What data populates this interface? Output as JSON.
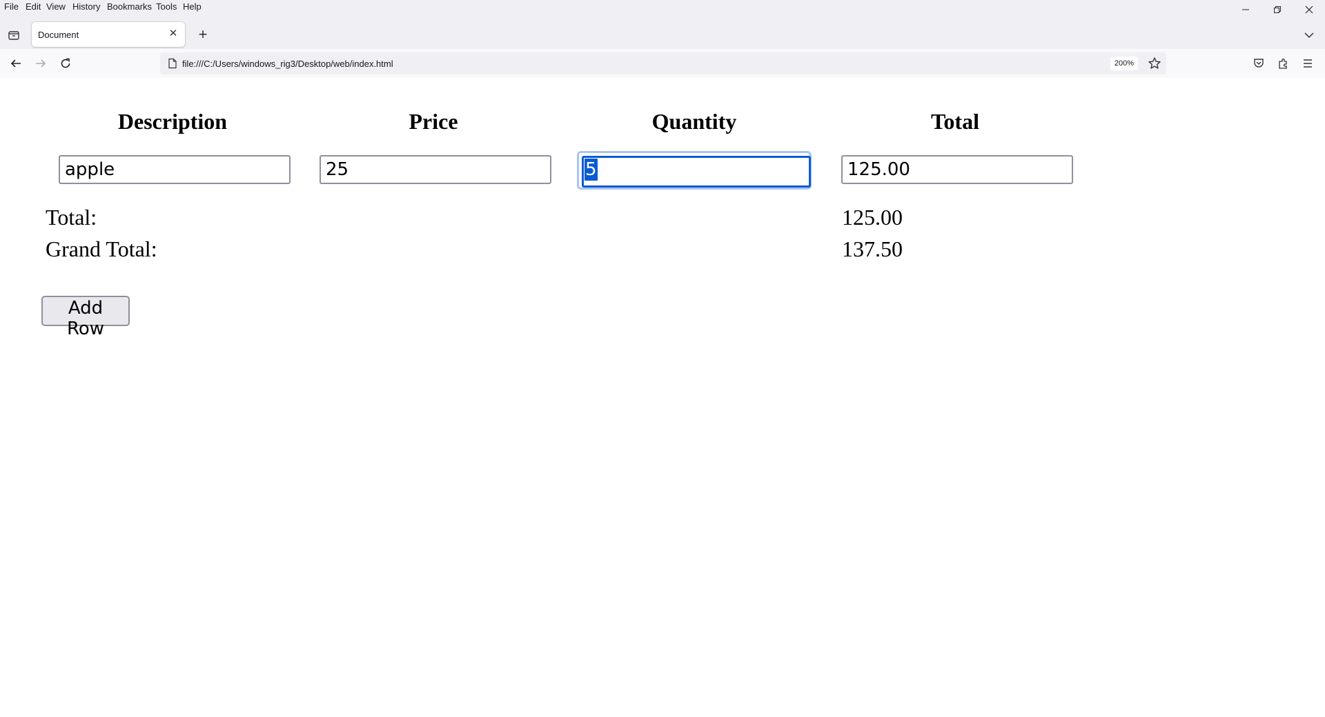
{
  "menu": [
    "File",
    "Edit",
    "View",
    "History",
    "Bookmarks",
    "Tools",
    "Help"
  ],
  "tab": {
    "title": "Document"
  },
  "address": {
    "url": "file:///C:/Users/windows_rig3/Desktop/web/index.html",
    "zoom": "200%"
  },
  "table": {
    "headers": {
      "description": "Description",
      "price": "Price",
      "quantity": "Quantity",
      "total": "Total"
    },
    "row": {
      "description": "apple",
      "price": "25",
      "quantity": "5",
      "total": "125.00"
    }
  },
  "summary": {
    "total_label": "Total:",
    "total_value": "125.00",
    "grand_label": "Grand Total:",
    "grand_value": "137.50"
  },
  "add_row_label": "Add Row",
  "colors": {
    "focus": "#0a5bd3",
    "focus_ring": "#a9c4ee",
    "chrome_bg": "#f0f0f4"
  }
}
